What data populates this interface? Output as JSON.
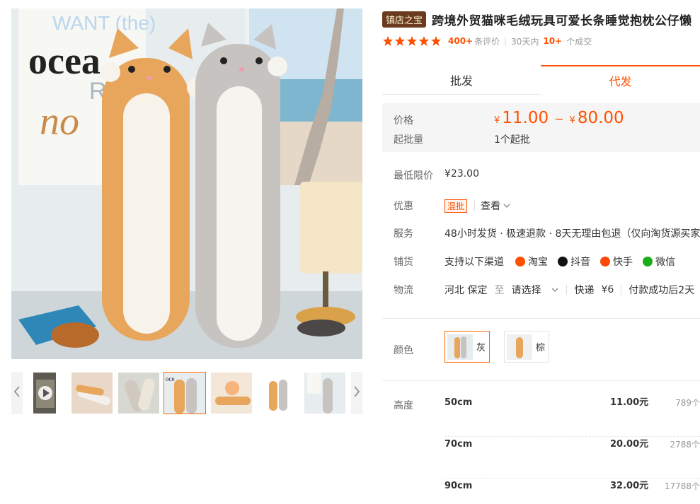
{
  "gallery": {
    "main_image_text": [
      "WANT (the)",
      "ocea",
      "RIGH",
      "no"
    ],
    "thumb_prev_icon": "chevron-left-icon",
    "thumb_next_icon": "chevron-right-icon",
    "video_icon": "play-icon",
    "thumbnails": [
      "video",
      "photo",
      "photo",
      "photo",
      "photo",
      "photo",
      "photo"
    ],
    "active_thumbnail_index": 3
  },
  "product": {
    "badge": "镇店之宝",
    "title": "跨境外贸猫咪毛绒玩具可爱长条睡觉抱枕公仔懒"
  },
  "rating": {
    "stars": 5,
    "star_color": "#ff5000",
    "reviews_count": "400+",
    "reviews_label": "条评价",
    "period_label": "30天内",
    "deals_count": "10+",
    "deals_label": "个成交"
  },
  "tabs": [
    {
      "label": "批发",
      "active": false
    },
    {
      "label": "代发",
      "active": true
    }
  ],
  "price": {
    "price_label": "价格",
    "currency": "¥",
    "min": "11.00",
    "tilde": "~",
    "max": "80.00",
    "moq_label": "起批量",
    "moq_value": "1个起批"
  },
  "min_price": {
    "label": "最低限价",
    "value": "¥23.00"
  },
  "promo": {
    "label": "优惠",
    "tag": "混批",
    "view": "查看"
  },
  "service": {
    "label": "服务",
    "value": "48小时发货 · 极速退款 · 8天无理由包退（仅向淘货源买家"
  },
  "channels": {
    "label": "铺货",
    "intro": "支持以下渠道",
    "items": [
      {
        "name": "淘宝",
        "icon": "taobao-icon",
        "color": "#ff5000"
      },
      {
        "name": "抖音",
        "icon": "douyin-icon",
        "color": "#111111"
      },
      {
        "name": "快手",
        "icon": "kuaishou-icon",
        "color": "#ff4906"
      },
      {
        "name": "微信",
        "icon": "wechat-icon",
        "color": "#1aad19"
      }
    ]
  },
  "logistics": {
    "label": "物流",
    "origin": "河北 保定",
    "to": "至",
    "dest": "请选择",
    "method": "快递",
    "fee": "¥6",
    "ship_note": "付款成功后2天"
  },
  "color": {
    "label": "颜色",
    "options": [
      {
        "name": "灰",
        "selected": true
      },
      {
        "name": "棕",
        "selected": false
      }
    ]
  },
  "sizes": {
    "label": "高度",
    "rows": [
      {
        "size": "50cm",
        "price": "11.00元",
        "stock": "789个"
      },
      {
        "size": "70cm",
        "price": "20.00元",
        "stock": "2788个"
      },
      {
        "size": "90cm",
        "price": "32.00元",
        "stock": "17788个"
      }
    ]
  },
  "colors": {
    "accent": "#ff5000",
    "badge_bg": "#6b3b1f",
    "price_bg": "#f5f5f5"
  }
}
